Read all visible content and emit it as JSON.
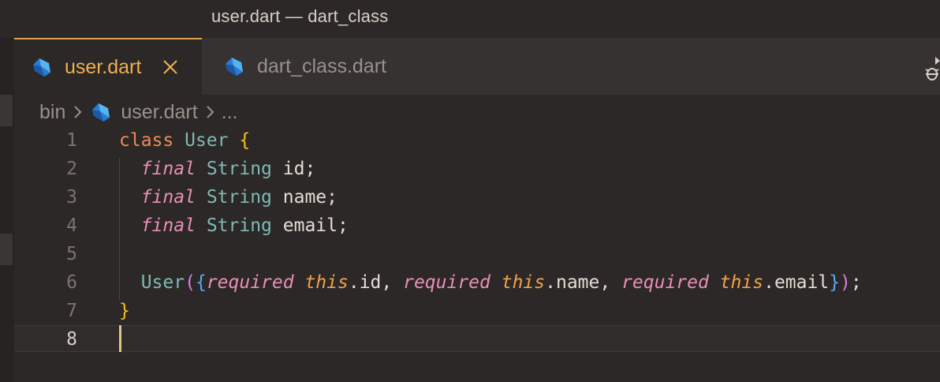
{
  "window": {
    "title": "user.dart — dart_class"
  },
  "tabs": [
    {
      "label": "user.dart",
      "active": true,
      "icon": "dart-icon"
    },
    {
      "label": "dart_class.dart",
      "active": false,
      "icon": "dart-icon"
    }
  ],
  "breadcrumb": {
    "folder": "bin",
    "file": "user.dart",
    "symbol": "..."
  },
  "editor": {
    "language": "dart",
    "current_line": 8,
    "line_numbers": [
      "1",
      "2",
      "3",
      "4",
      "5",
      "6",
      "7",
      "8"
    ],
    "lines": [
      "class User {",
      "  final String id;",
      "  final String name;",
      "  final String email;",
      "",
      "  User({required this.id, required this.name, required this.email});",
      "}",
      ""
    ],
    "tokens": {
      "l1": {
        "kw": "class",
        "type": "User",
        "brace": "{"
      },
      "l2": {
        "kw": "final",
        "type": "String",
        "rest": "id;"
      },
      "l3": {
        "kw": "final",
        "type": "String",
        "rest": "name;"
      },
      "l4": {
        "kw": "final",
        "type": "String",
        "rest": "email;"
      },
      "l6": {
        "ctor": "User",
        "p1": "(",
        "b1": "{",
        "req1": "required",
        "this1": "this",
        "f1": ".id, ",
        "req2": "required",
        "this2": "this",
        "f2": ".name, ",
        "req3": "required",
        "this3": "this",
        "f3": ".email",
        "b2": "}",
        "p2": ")",
        "end": ";"
      },
      "l7": {
        "brace": "}"
      }
    }
  },
  "colors": {
    "accent": "#f0b04f",
    "background": "#2b2827",
    "tabbar": "#353231"
  }
}
